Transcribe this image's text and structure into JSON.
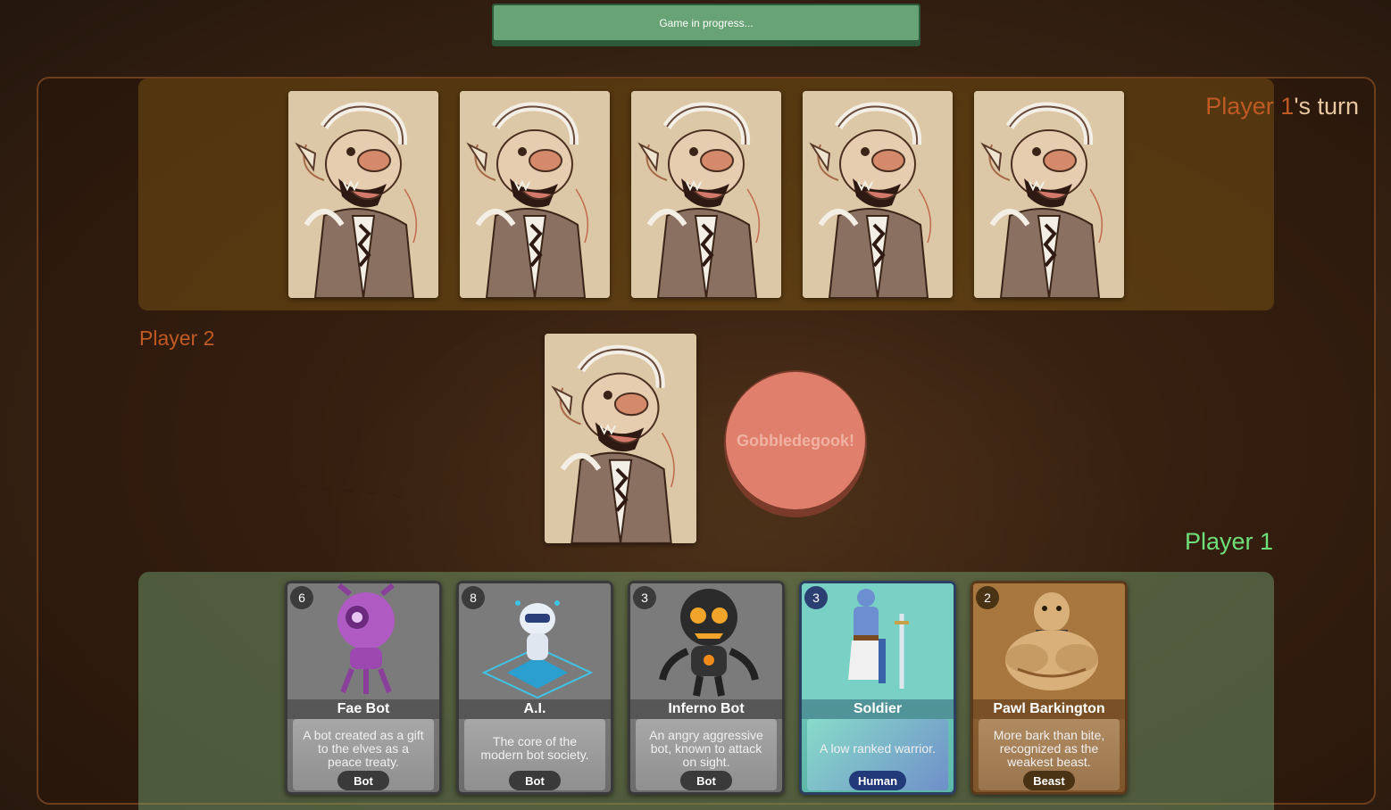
{
  "status": {
    "text": "Game in progress..."
  },
  "turn": {
    "player": "Player 1",
    "suffix": "'s turn"
  },
  "opponent": {
    "name": "Player 2",
    "hand_count": 5
  },
  "player": {
    "name": "Player 1"
  },
  "gobble_button": {
    "label": "Gobbledegook!"
  },
  "hand": [
    {
      "cost": "6",
      "name": "Fae Bot",
      "description": "A bot created as a gift to the elves as a peace treaty.",
      "type": "Bot",
      "icon": "purple-robot-icon"
    },
    {
      "cost": "8",
      "name": "A.I.",
      "description": "The core of the modern bot society.",
      "type": "Bot",
      "icon": "ai-chip-robot-icon"
    },
    {
      "cost": "3",
      "name": "Inferno Bot",
      "description": "An angry aggressive bot, known to attack on sight.",
      "type": "Bot",
      "icon": "fire-robot-icon"
    },
    {
      "cost": "3",
      "name": "Soldier",
      "description": "A low ranked warrior.",
      "type": "Human",
      "icon": "knight-icon"
    },
    {
      "cost": "2",
      "name": "Pawl Barkington",
      "description": "More bark than bite, recognized as the weakest beast.",
      "type": "Beast",
      "icon": "muscular-dog-icon"
    }
  ],
  "colors": {
    "player1": "#6ee07a",
    "player2": "#c05a24",
    "status_bar": "#67a374",
    "gobble": "#df7f6c"
  }
}
